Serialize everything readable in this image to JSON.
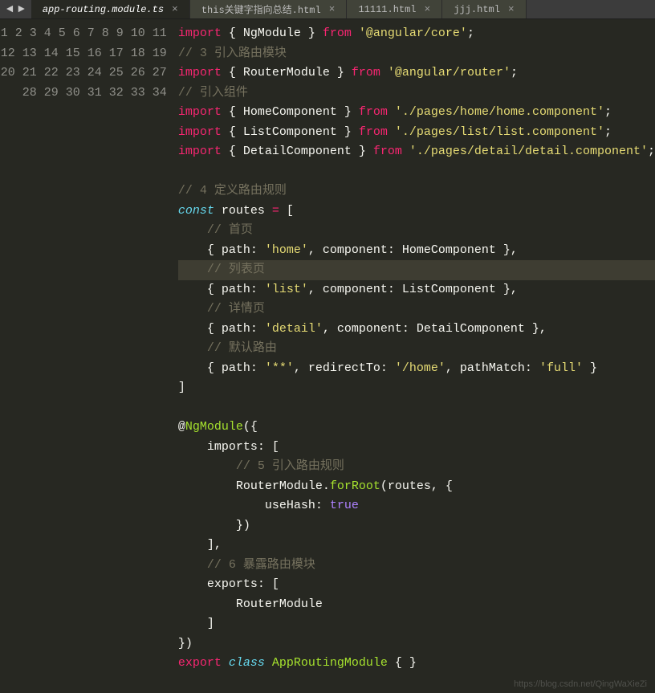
{
  "tabs": [
    {
      "label": "app-routing.module.ts",
      "active": true
    },
    {
      "label": "this关键字指向总结.html",
      "active": false
    },
    {
      "label": "11111.html",
      "active": false
    },
    {
      "label": "jjj.html",
      "active": false
    }
  ],
  "gutter_start": 1,
  "gutter_end": 34,
  "current_line": 13,
  "code_lines": [
    [
      [
        "kw-red",
        "import"
      ],
      [
        "punc",
        " { "
      ],
      [
        "prop",
        "NgModule"
      ],
      [
        "punc",
        " } "
      ],
      [
        "kw-red",
        "from"
      ],
      [
        "punc",
        " "
      ],
      [
        "str",
        "'@angular/core'"
      ],
      [
        "punc",
        ";"
      ]
    ],
    [
      [
        "cmt",
        "// 3 引入路由模块"
      ]
    ],
    [
      [
        "kw-red",
        "import"
      ],
      [
        "punc",
        " { "
      ],
      [
        "prop",
        "RouterModule"
      ],
      [
        "punc",
        " } "
      ],
      [
        "kw-red",
        "from"
      ],
      [
        "punc",
        " "
      ],
      [
        "str",
        "'@angular/router'"
      ],
      [
        "punc",
        ";"
      ]
    ],
    [
      [
        "cmt",
        "// 引入组件"
      ]
    ],
    [
      [
        "kw-red",
        "import"
      ],
      [
        "punc",
        " { "
      ],
      [
        "prop",
        "HomeComponent"
      ],
      [
        "punc",
        " } "
      ],
      [
        "kw-red",
        "from"
      ],
      [
        "punc",
        " "
      ],
      [
        "str",
        "'./pages/home/home.component'"
      ],
      [
        "punc",
        ";"
      ]
    ],
    [
      [
        "kw-red",
        "import"
      ],
      [
        "punc",
        " { "
      ],
      [
        "prop",
        "ListComponent"
      ],
      [
        "punc",
        " } "
      ],
      [
        "kw-red",
        "from"
      ],
      [
        "punc",
        " "
      ],
      [
        "str",
        "'./pages/list/list.component'"
      ],
      [
        "punc",
        ";"
      ]
    ],
    [
      [
        "kw-red",
        "import"
      ],
      [
        "punc",
        " { "
      ],
      [
        "prop",
        "DetailComponent"
      ],
      [
        "punc",
        " } "
      ],
      [
        "kw-red",
        "from"
      ],
      [
        "punc",
        " "
      ],
      [
        "str",
        "'./pages/detail/detail.component'"
      ],
      [
        "punc",
        ";"
      ]
    ],
    [],
    [
      [
        "cmt",
        "// 4 定义路由规则"
      ]
    ],
    [
      [
        "kw-cyan",
        "const"
      ],
      [
        "punc",
        " routes "
      ],
      [
        "kw-red",
        "="
      ],
      [
        "punc",
        " ["
      ]
    ],
    [
      [
        "guide",
        "    "
      ],
      [
        "cmt",
        "// 首页"
      ]
    ],
    [
      [
        "guide",
        "    "
      ],
      [
        "punc",
        "{ path: "
      ],
      [
        "str",
        "'home'"
      ],
      [
        "punc",
        ", component: HomeComponent },"
      ]
    ],
    [
      [
        "guide",
        "    "
      ],
      [
        "cmt",
        "// 列表页"
      ]
    ],
    [
      [
        "guide",
        "    "
      ],
      [
        "punc",
        "{ path: "
      ],
      [
        "str",
        "'list'"
      ],
      [
        "punc",
        ", component: ListComponent },"
      ]
    ],
    [
      [
        "guide",
        "    "
      ],
      [
        "cmt",
        "// 详情页"
      ]
    ],
    [
      [
        "guide",
        "    "
      ],
      [
        "punc",
        "{ path: "
      ],
      [
        "str",
        "'detail'"
      ],
      [
        "punc",
        ", component: DetailComponent },"
      ]
    ],
    [
      [
        "guide",
        "    "
      ],
      [
        "cmt",
        "// 默认路由"
      ]
    ],
    [
      [
        "guide",
        "    "
      ],
      [
        "punc",
        "{ path: "
      ],
      [
        "str",
        "'**'"
      ],
      [
        "punc",
        ", redirectTo: "
      ],
      [
        "str",
        "'/home'"
      ],
      [
        "punc",
        ", pathMatch: "
      ],
      [
        "str",
        "'full'"
      ],
      [
        "punc",
        " }"
      ]
    ],
    [
      [
        "punc",
        "]"
      ]
    ],
    [],
    [
      [
        "punc",
        "@"
      ],
      [
        "fn",
        "NgModule"
      ],
      [
        "punc",
        "({"
      ]
    ],
    [
      [
        "guide",
        "    "
      ],
      [
        "punc",
        "imports: ["
      ]
    ],
    [
      [
        "guide",
        "        "
      ],
      [
        "cmt",
        "// 5 引入路由规则"
      ]
    ],
    [
      [
        "guide",
        "        "
      ],
      [
        "punc",
        "RouterModule."
      ],
      [
        "fn",
        "forRoot"
      ],
      [
        "punc",
        "(routes, {"
      ]
    ],
    [
      [
        "guide",
        "            "
      ],
      [
        "punc",
        "useHash: "
      ],
      [
        "bool",
        "true"
      ]
    ],
    [
      [
        "guide",
        "        "
      ],
      [
        "punc",
        "})"
      ]
    ],
    [
      [
        "guide",
        "    "
      ],
      [
        "punc",
        "],"
      ]
    ],
    [
      [
        "guide",
        "    "
      ],
      [
        "cmt",
        "// 6 暴露路由模块"
      ]
    ],
    [
      [
        "guide",
        "    "
      ],
      [
        "punc",
        "exports: ["
      ]
    ],
    [
      [
        "guide",
        "        "
      ],
      [
        "punc",
        "RouterModule"
      ]
    ],
    [
      [
        "guide",
        "    "
      ],
      [
        "punc",
        "]"
      ]
    ],
    [
      [
        "punc",
        "})"
      ]
    ],
    [
      [
        "kw-red",
        "export"
      ],
      [
        "punc",
        " "
      ],
      [
        "kw-cyan",
        "class"
      ],
      [
        "punc",
        " "
      ],
      [
        "cls",
        "AppRoutingModule"
      ],
      [
        "punc",
        " { }"
      ]
    ],
    []
  ],
  "watermark": "https://blog.csdn.net/QingWaXieZi"
}
